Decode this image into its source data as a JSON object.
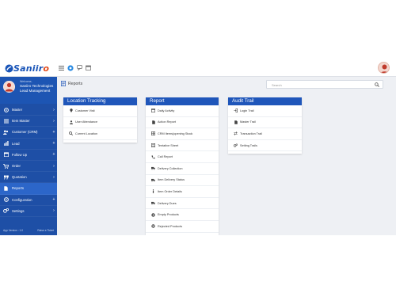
{
  "app": {
    "brand_prefix": "Saniir",
    "brand_suffix": "o",
    "brand_accent": "#e24a1b",
    "brand_color": "#1a55b8"
  },
  "topbar": {
    "icons": [
      "hamburger-icon",
      "chat-icon",
      "comments-icon",
      "calendar-icon"
    ]
  },
  "sidebar": {
    "welcome": "Welcome,",
    "org_name": "Saniiro Technologies Lead Management",
    "items": [
      {
        "label": "Master",
        "icon": "gear-icon",
        "arrow": "›"
      },
      {
        "label": "Item Master",
        "icon": "list-icon",
        "arrow": "›"
      },
      {
        "label": "Customer (CRM)",
        "icon": "users-icon",
        "arrow": "+"
      },
      {
        "label": "Lead",
        "icon": "chart-icon",
        "arrow": "+"
      },
      {
        "label": "Follow Up",
        "icon": "calendar-icon",
        "arrow": "+"
      },
      {
        "label": "Order",
        "icon": "cart-icon",
        "arrow": "›"
      },
      {
        "label": "Quotation",
        "icon": "quote-icon",
        "arrow": "›"
      },
      {
        "label": "Reports",
        "icon": "file-icon",
        "arrow": ""
      },
      {
        "label": "Configuration",
        "icon": "gear-icon",
        "arrow": "+"
      },
      {
        "label": "Settings",
        "icon": "cogs-icon",
        "arrow": "›"
      }
    ],
    "footer_left": "App Version : 1.0",
    "footer_right": "Raise a Ticket"
  },
  "page": {
    "title": "Reports",
    "search_placeholder": "Search"
  },
  "cards": {
    "location": {
      "title": "Location Tracking",
      "items": [
        {
          "label": "Customer Visit",
          "icon": "marker-icon"
        },
        {
          "label": "User Attendance",
          "icon": "user-icon"
        },
        {
          "label": "Current Location",
          "icon": "search-icon"
        }
      ]
    },
    "report": {
      "title": "Report",
      "items": [
        {
          "label": "Daily Activity",
          "icon": "calendar-icon"
        },
        {
          "label": "Action Report",
          "icon": "file-icon"
        },
        {
          "label": "CRM Items(opening Stock",
          "icon": "table-icon"
        },
        {
          "label": "Tentative Sheet",
          "icon": "sheet-icon"
        },
        {
          "label": "Call Report",
          "icon": "phone-icon"
        },
        {
          "label": "Delivery Collection",
          "icon": "truck-icon"
        },
        {
          "label": "Item Delivery Status",
          "icon": "truck-icon"
        },
        {
          "label": "Item Order Details",
          "icon": "info-icon"
        },
        {
          "label": "Delivery Dues",
          "icon": "truck-icon"
        },
        {
          "label": "Empty Products",
          "icon": "box-icon"
        },
        {
          "label": "Rejected Products",
          "icon": "reject-icon"
        }
      ]
    },
    "audit": {
      "title": "Audit Trail",
      "items": [
        {
          "label": "Login Trail",
          "icon": "login-icon"
        },
        {
          "label": "Master Trail",
          "icon": "file-icon"
        },
        {
          "label": "Transaction Trail",
          "icon": "exchange-icon"
        },
        {
          "label": "Setting Trails",
          "icon": "cogs-icon"
        }
      ]
    }
  }
}
